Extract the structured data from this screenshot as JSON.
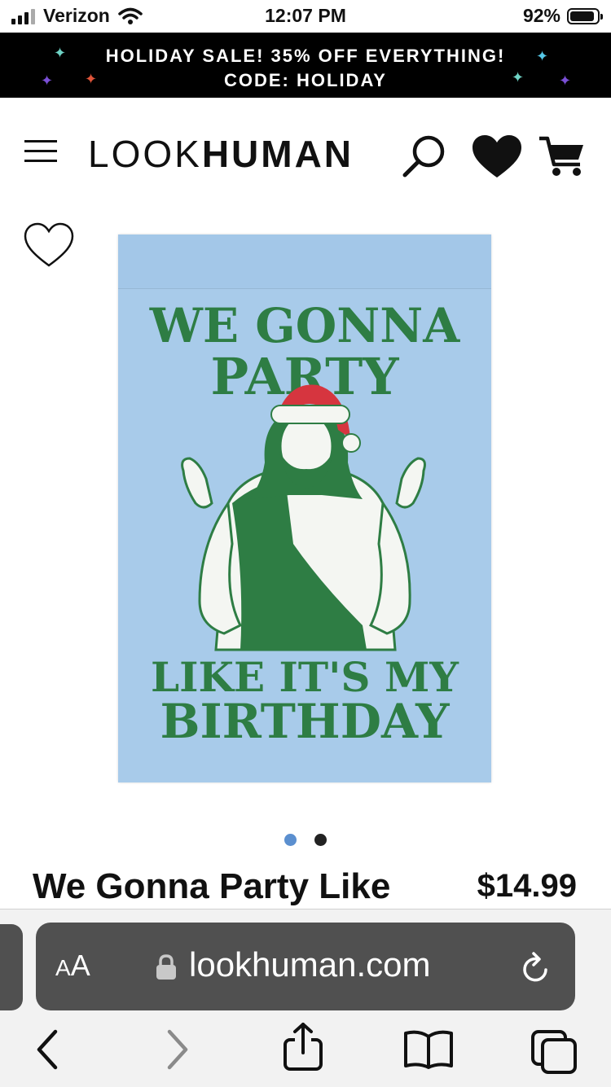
{
  "status_bar": {
    "carrier": "Verizon",
    "time": "12:07 PM",
    "battery": "92%",
    "battery_level": 0.92
  },
  "promo": {
    "line1": "HOLIDAY SALE! 35% OFF EVERYTHING!",
    "line2": "CODE: HOLIDAY",
    "sparkle_colors": [
      "#6fd3c5",
      "#7a4fd6",
      "#e0553a",
      "#56c8e8"
    ]
  },
  "header": {
    "logo_light": "LOOK",
    "logo_bold": "HUMAN",
    "icons": [
      "menu-icon",
      "search-icon",
      "heart-icon",
      "cart-icon"
    ]
  },
  "product": {
    "image_text": {
      "top1": "WE GONNA",
      "top2": "PARTY",
      "bottom1": "LIKE IT'S MY",
      "bottom2": "BIRTHDAY"
    },
    "title": "We Gonna Party Like",
    "price": "$14.99",
    "carousel": {
      "total": 2,
      "active": 1
    },
    "colors": {
      "flag": "#a8cbea",
      "ink": "#2e7d44",
      "hat": "#d6353f"
    }
  },
  "browser": {
    "aa_label": "AA",
    "url": "lookhuman.com",
    "nav_icons": [
      "back-icon",
      "forward-icon",
      "share-icon",
      "bookmarks-icon",
      "tabs-icon"
    ]
  }
}
